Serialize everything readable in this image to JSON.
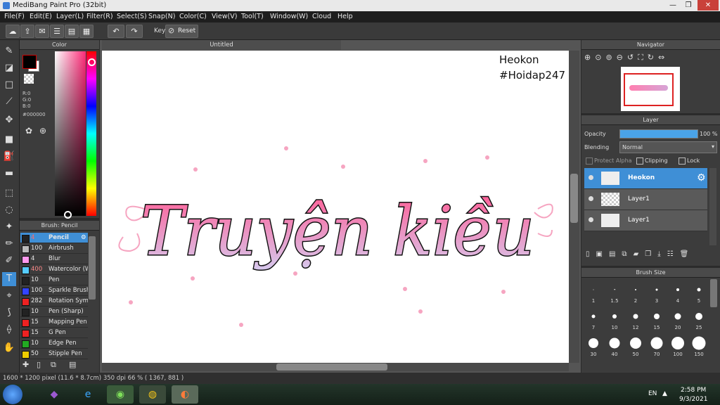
{
  "window": {
    "title": "MediBang Paint Pro (32bit)",
    "min": "—",
    "max": "❐",
    "close": "✕"
  },
  "menu": [
    "File(F)",
    "Edit(E)",
    "Layer(L)",
    "Filter(R)",
    "Select(S)",
    "Snap(N)",
    "Color(C)",
    "View(V)",
    "Tool(T)",
    "Window(W)",
    "Cloud",
    "Help"
  ],
  "toolbar": {
    "key_label": "Key",
    "reset_label": "Reset"
  },
  "color_panel": {
    "title": "Color",
    "r": "R:0",
    "g": "G:0",
    "b": "B:0",
    "hex": "#000000",
    "main_color": "#000000",
    "sub_color": "#ffffff"
  },
  "brush_panel": {
    "title": "Brush: Pencil",
    "items": [
      {
        "size": "4",
        "name": "Pencil",
        "color": "#222222"
      },
      {
        "size": "100",
        "name": "Airbrush",
        "color": "#bbbbbb"
      },
      {
        "size": "4",
        "name": "Blur",
        "color": "#ff99ee"
      },
      {
        "size": "400",
        "name": "Watercolor (W",
        "color": "#55ccff"
      },
      {
        "size": "10",
        "name": "Pen",
        "color": "#222222"
      },
      {
        "size": "100",
        "name": "Sparkle Brush",
        "color": "#3344ff"
      },
      {
        "size": "282",
        "name": "Rotation Sym",
        "color": "#ee2222"
      },
      {
        "size": "10",
        "name": "Pen (Sharp)",
        "color": "#222222"
      },
      {
        "size": "15",
        "name": "Mapping Pen",
        "color": "#ee2222"
      },
      {
        "size": "15",
        "name": "G Pen",
        "color": "#ee2222"
      },
      {
        "size": "10",
        "name": "Edge Pen",
        "color": "#22aa22"
      },
      {
        "size": "50",
        "name": "Stipple Pen",
        "color": "#eecc00"
      }
    ]
  },
  "canvas": {
    "tab": "Untitled",
    "watermark_line1": "Heokon",
    "watermark_line2": "#Hoidap247",
    "artwork_text": "Truyện kiều"
  },
  "navigator": {
    "title": "Navigator"
  },
  "layer_panel": {
    "title": "Layer",
    "opacity_label": "Opacity",
    "opacity_value": "100 %",
    "opacity_fraction": 1.0,
    "blending_label": "Blending",
    "blending_value": "Normal",
    "protect_alpha": "Protect Alpha",
    "clipping": "Clipping",
    "lock": "Lock",
    "layers": [
      {
        "name": "Heokon",
        "selected": true
      },
      {
        "name": "Layer1",
        "selected": false
      },
      {
        "name": "Layer1",
        "selected": false
      }
    ]
  },
  "brush_size": {
    "title": "Brush Size",
    "sizes": [
      "1",
      "1.5",
      "2",
      "3",
      "4",
      "5",
      "7",
      "10",
      "12",
      "15",
      "20",
      "25",
      "30",
      "40",
      "50",
      "70",
      "100",
      "150"
    ]
  },
  "status": {
    "text": "1600 * 1200 pixel   (11.6 * 8.7cm)   350 dpi   66 %   ( 1367, 881 )"
  },
  "taskbar": {
    "lang": "EN",
    "time": "2:58 PM",
    "date": "9/3/2021"
  }
}
